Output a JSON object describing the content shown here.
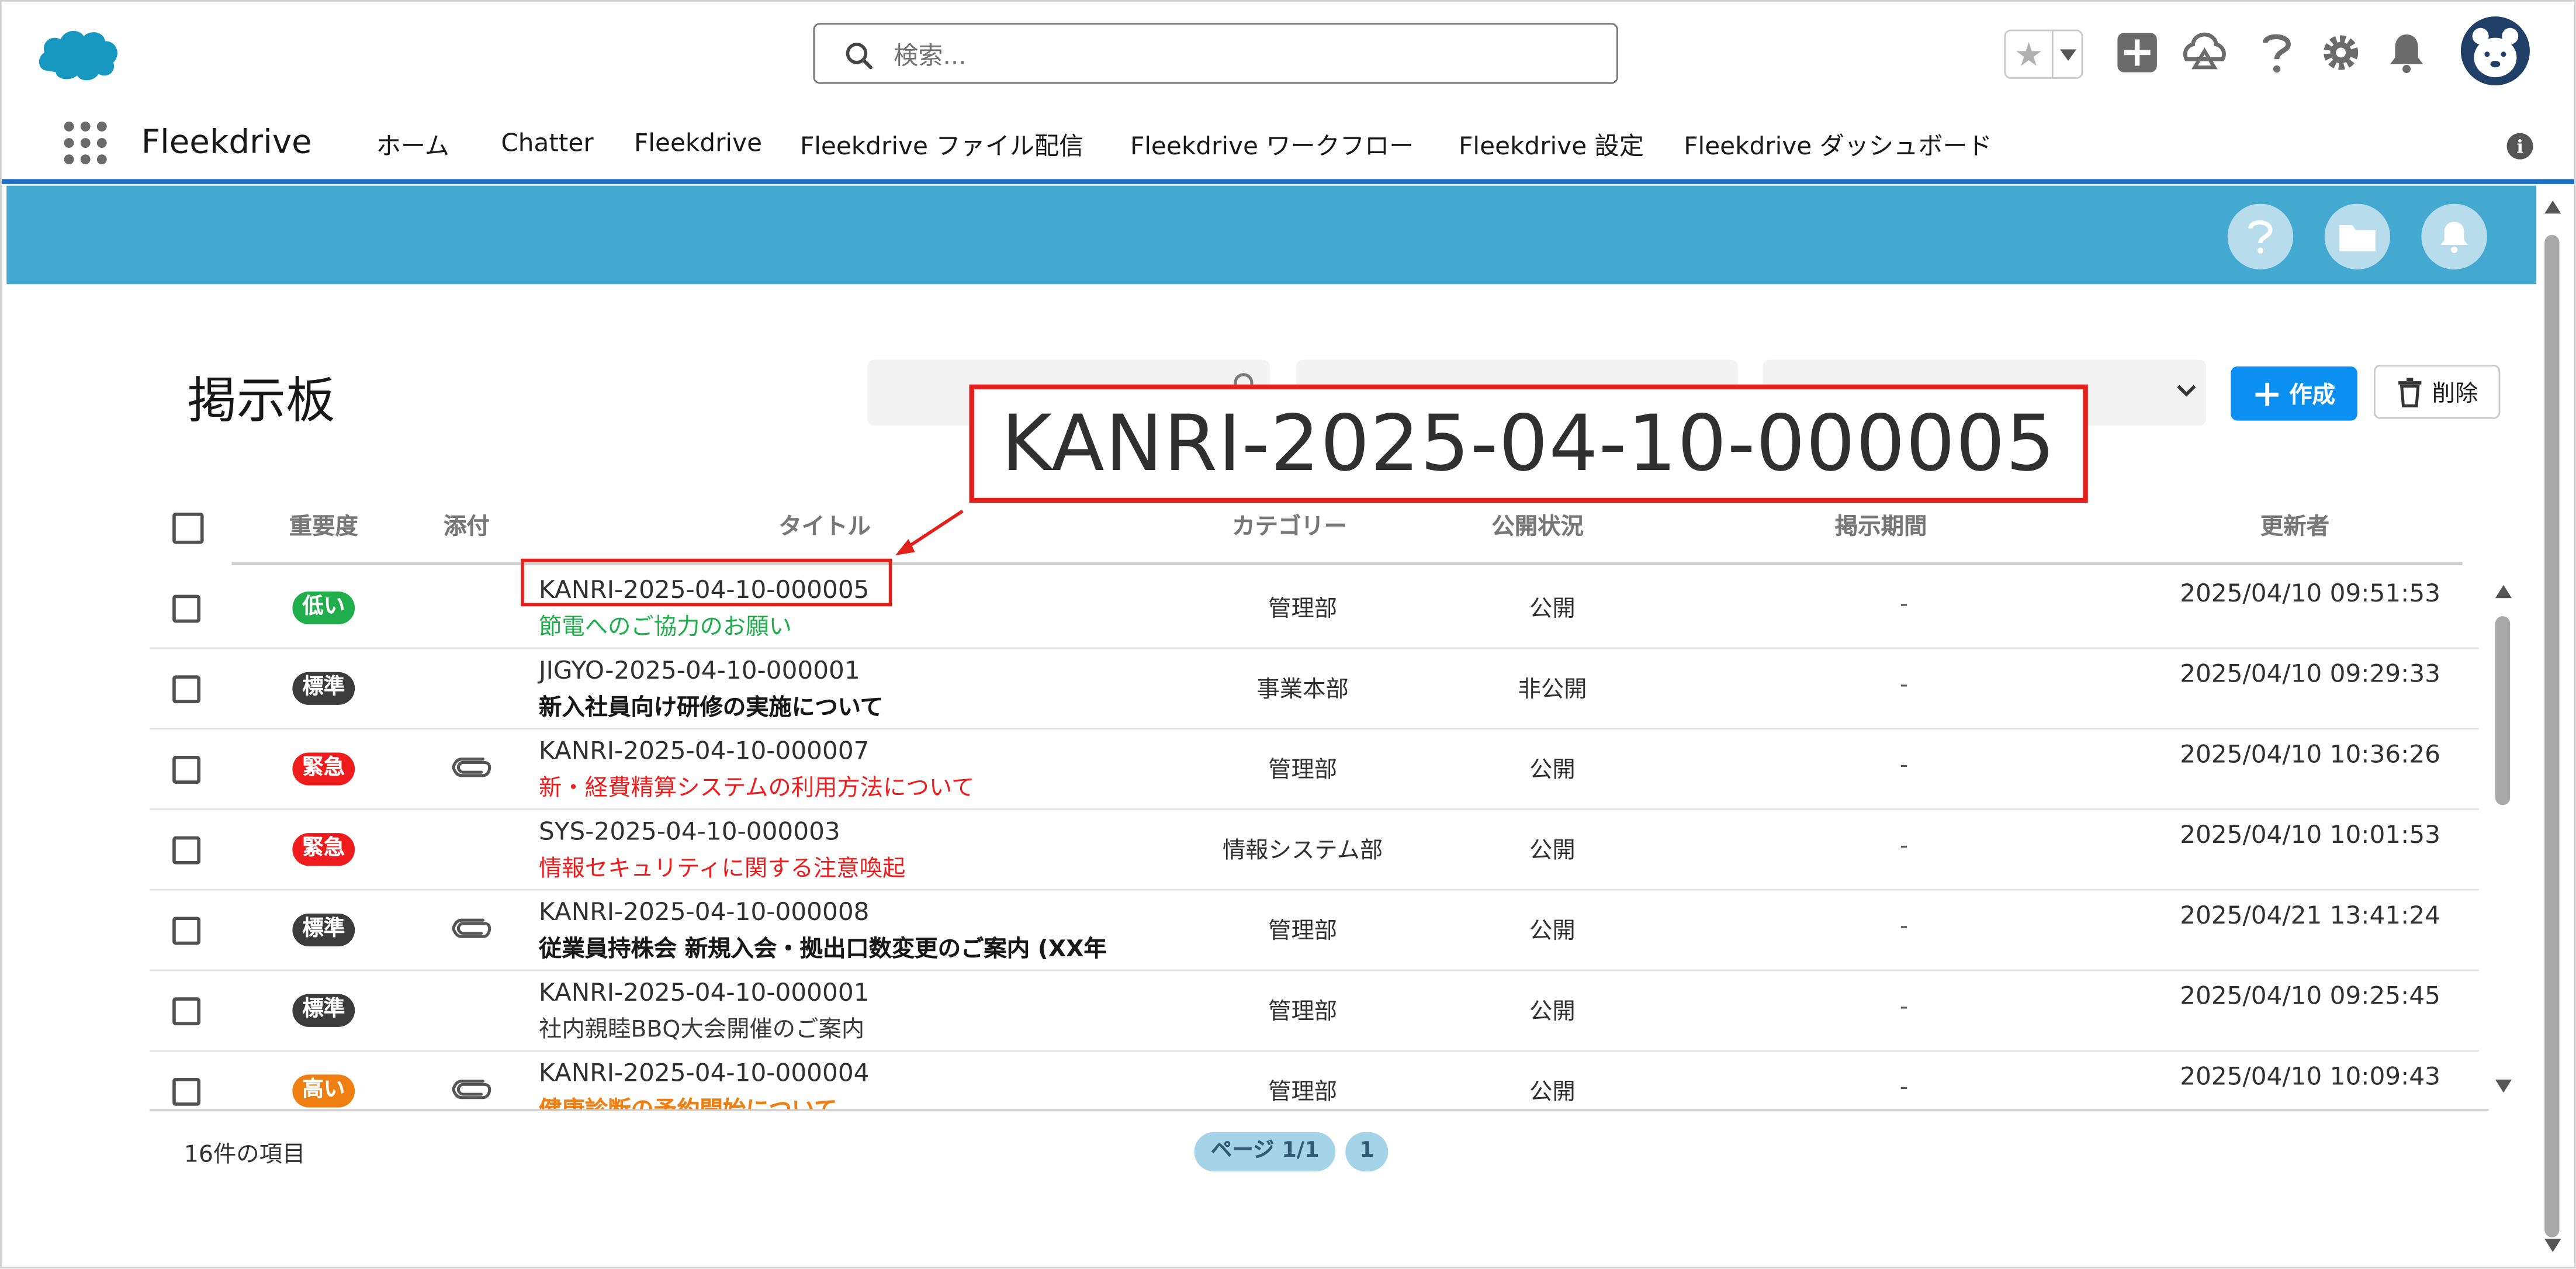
{
  "header": {
    "search_placeholder": "検索...",
    "icons": [
      "salesforce-cloud-logo",
      "search-icon",
      "star-icon",
      "chevron-down-icon",
      "plus-icon",
      "trailhead-icon",
      "help-icon",
      "gear-icon",
      "bell-icon",
      "avatar"
    ]
  },
  "nav": {
    "app_name": "Fleekdrive",
    "items": [
      "ホーム",
      "Chatter",
      "Fleekdrive",
      "Fleekdrive ファイル配信",
      "Fleekdrive ワークフロー",
      "Fleekdrive 設定",
      "Fleekdrive ダッシュボード"
    ]
  },
  "banner": {
    "color": "#43a9d1",
    "icons": [
      "help-icon",
      "folder-icon",
      "bell-icon"
    ]
  },
  "page": {
    "title": "掲示板",
    "create_label": "作成",
    "delete_label": "削除"
  },
  "callout": {
    "text": "KANRI-2025-04-10-000005",
    "color": "#e3211c"
  },
  "table": {
    "columns": [
      "重要度",
      "添付",
      "タイトル",
      "カテゴリー",
      "公開状況",
      "掲示期間",
      "更新者"
    ],
    "rows": [
      {
        "priority": "低い",
        "priority_color": "#1fae4b",
        "attachment": false,
        "id": "KANRI-2025-04-10-000005",
        "title": "節電へのご協力のお願い",
        "title_color": "#1fae4b",
        "title_bold": false,
        "category": "管理部",
        "status": "公開",
        "period": "-",
        "updated": "2025/04/10 09:51:53"
      },
      {
        "priority": "標準",
        "priority_color": "#3b3b3b",
        "attachment": false,
        "id": "JIGYO-2025-04-10-000001",
        "title": "新入社員向け研修の実施について",
        "title_color": "#181818",
        "title_bold": true,
        "category": "事業本部",
        "status": "非公開",
        "period": "-",
        "updated": "2025/04/10 09:29:33"
      },
      {
        "priority": "緊急",
        "priority_color": "#ee1c1c",
        "attachment": true,
        "id": "KANRI-2025-04-10-000007",
        "title": "新・経費精算システムの利用方法について",
        "title_color": "#ee1c1c",
        "title_bold": false,
        "category": "管理部",
        "status": "公開",
        "period": "-",
        "updated": "2025/04/10 10:36:26"
      },
      {
        "priority": "緊急",
        "priority_color": "#ee1c1c",
        "attachment": false,
        "id": "SYS-2025-04-10-000003",
        "title": "情報セキュリティに関する注意喚起",
        "title_color": "#ee1c1c",
        "title_bold": false,
        "category": "情報システム部",
        "status": "公開",
        "period": "-",
        "updated": "2025/04/10 10:01:53"
      },
      {
        "priority": "標準",
        "priority_color": "#3b3b3b",
        "attachment": true,
        "id": "KANRI-2025-04-10-000008",
        "title": "従業員持株会 新規入会・拠出口数変更のご案内 (XX年",
        "title_color": "#181818",
        "title_bold": true,
        "category": "管理部",
        "status": "公開",
        "period": "-",
        "updated": "2025/04/21 13:41:24"
      },
      {
        "priority": "標準",
        "priority_color": "#3b3b3b",
        "attachment": false,
        "id": "KANRI-2025-04-10-000001",
        "title": "社内親睦BBQ大会開催のご案内",
        "title_color": "#3a3a3a",
        "title_bold": false,
        "category": "管理部",
        "status": "公開",
        "period": "-",
        "updated": "2025/04/10 09:25:45"
      },
      {
        "priority": "高い",
        "priority_color": "#f07f12",
        "attachment": true,
        "id": "KANRI-2025-04-10-000004",
        "title": "健康診断の予約開始について",
        "title_color": "#f07f12",
        "title_bold": true,
        "category": "管理部",
        "status": "公開",
        "period": "-",
        "updated": "2025/04/10 10:09:43"
      }
    ]
  },
  "footer": {
    "count_text": "16件の項目",
    "page_label": "ページ 1/1",
    "page_number": "1"
  }
}
